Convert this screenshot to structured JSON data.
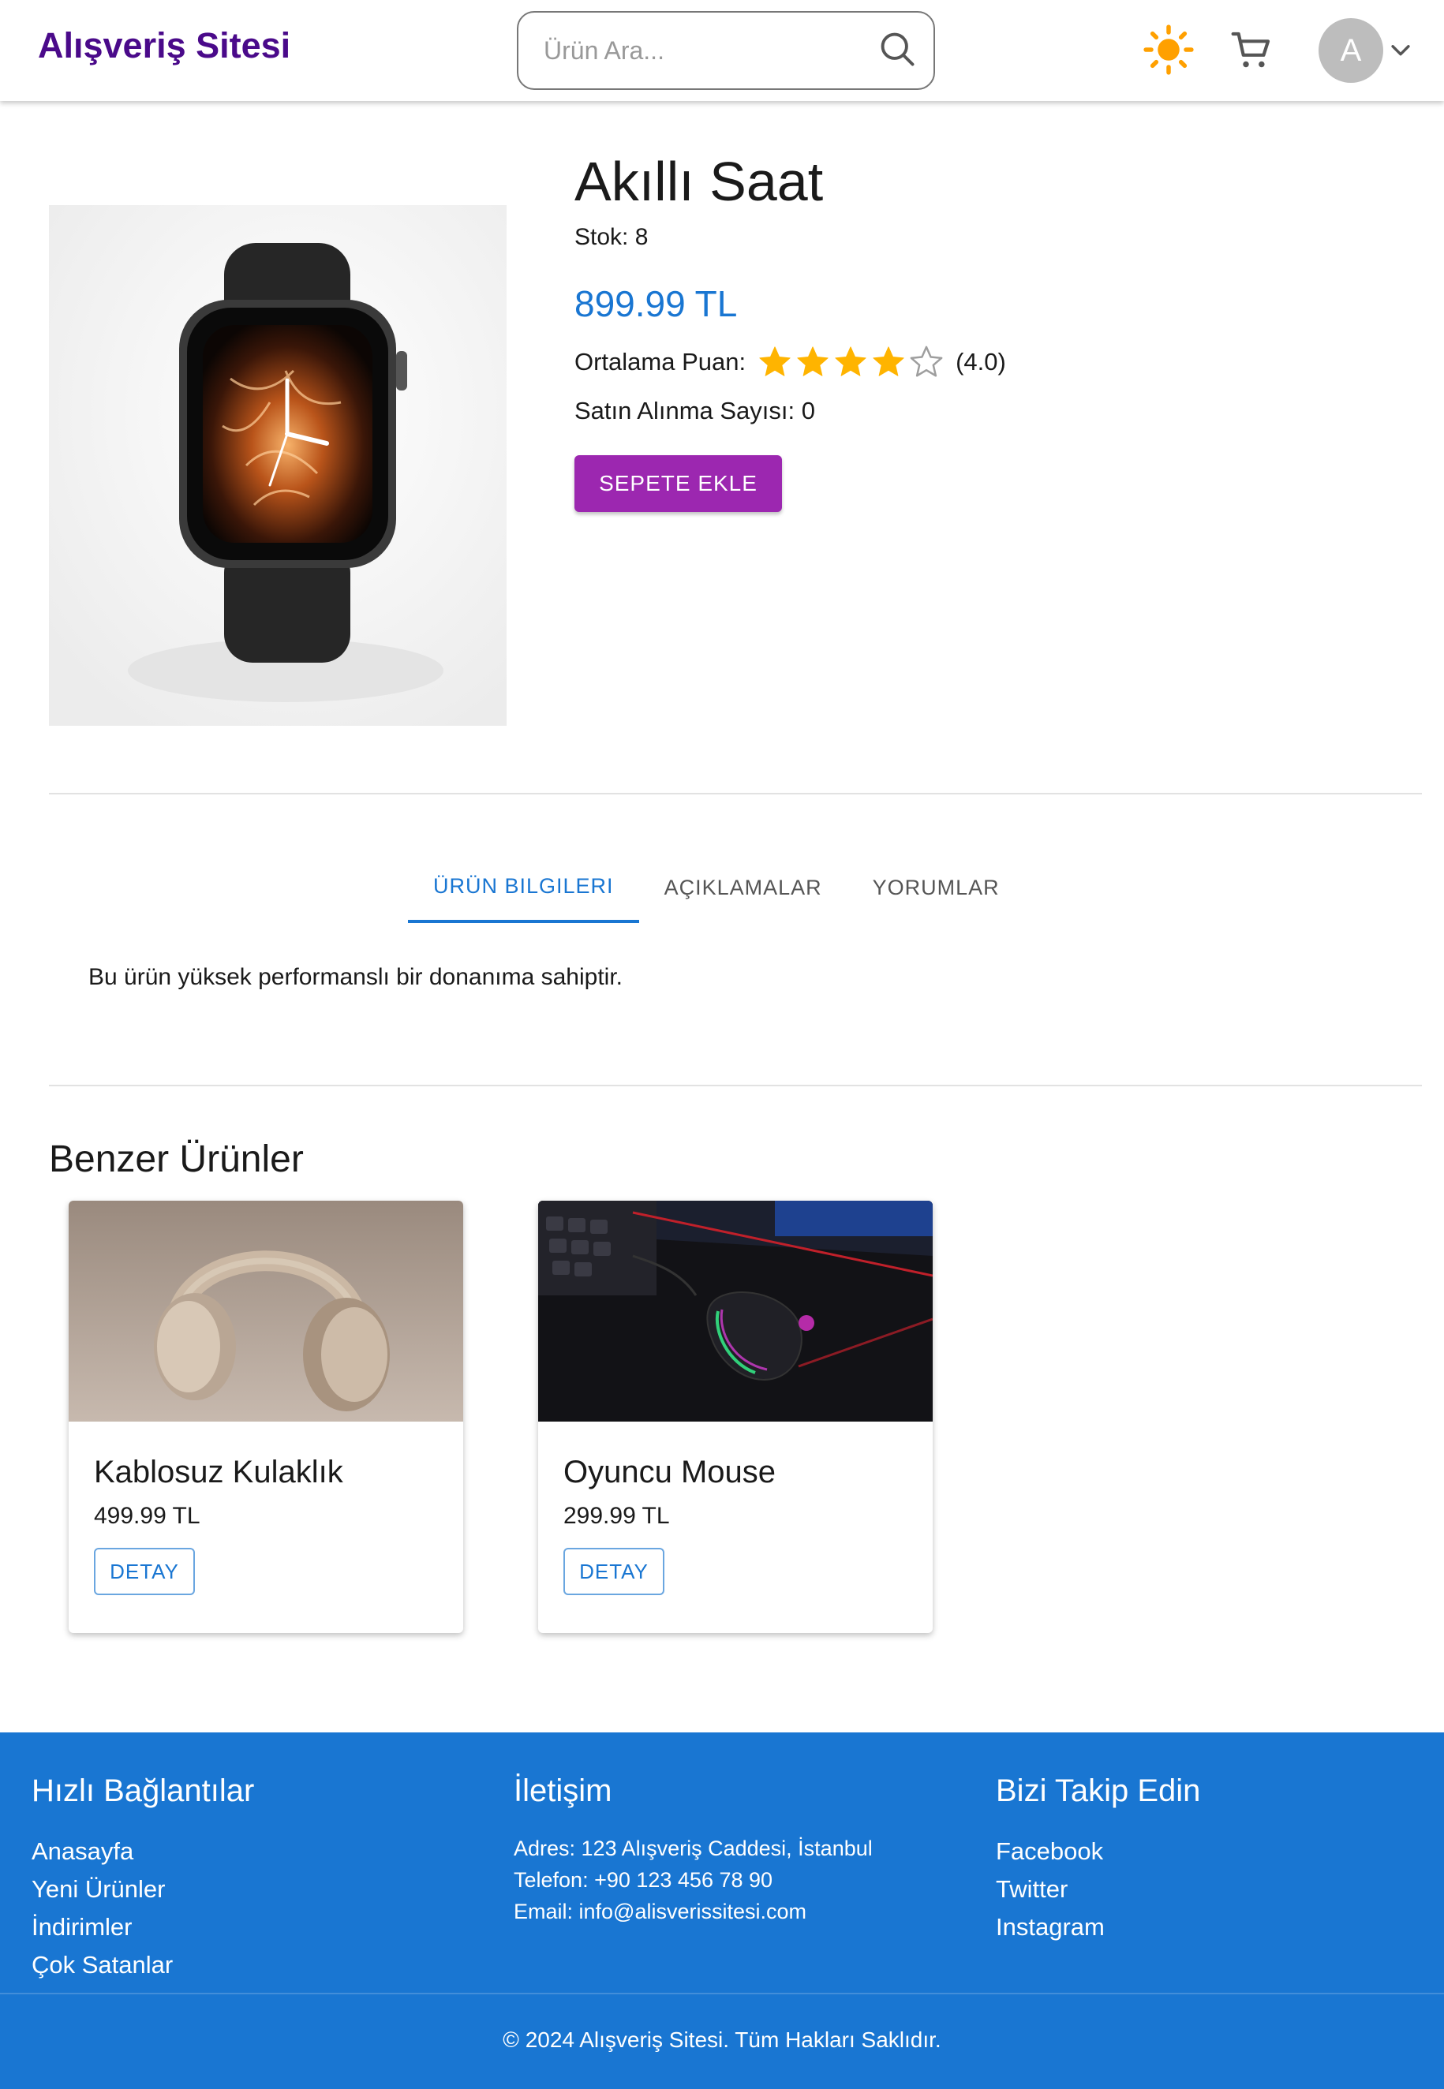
{
  "header": {
    "logo": "Alışveriş Sitesi",
    "search_placeholder": "Ürün Ara...",
    "avatar_letter": "A"
  },
  "product": {
    "title": "Akıllı Saat",
    "stock": "Stok: 8",
    "price": "899.99 TL",
    "rating_label": "Ortalama Puan:",
    "rating_value": 4,
    "rating_max": 5,
    "rating_text": "(4.0)",
    "sales": "Satın Alınma Sayısı: 0",
    "add_to_cart": "SEPETE EKLE"
  },
  "tabs": [
    {
      "label": "ÜRÜN BILGILERI",
      "active": true
    },
    {
      "label": "AÇIKLAMALAR",
      "active": false
    },
    {
      "label": "YORUMLAR",
      "active": false
    }
  ],
  "tab_content": "Bu ürün yüksek performanslı bir donanıma sahiptir.",
  "similar": {
    "title": "Benzer Ürünler",
    "items": [
      {
        "name": "Kablosuz Kulaklık",
        "price": "499.99 TL",
        "button": "DETAY"
      },
      {
        "name": "Oyuncu Mouse",
        "price": "299.99 TL",
        "button": "DETAY"
      }
    ]
  },
  "footer": {
    "quick_links": {
      "title": "Hızlı Bağlantılar",
      "links": [
        "Anasayfa",
        "Yeni Ürünler",
        "İndirimler",
        "Çok Satanlar"
      ]
    },
    "contact": {
      "title": "İletişim",
      "lines": [
        "Adres: 123 Alışveriş Caddesi, İstanbul",
        "Telefon: +90 123 456 78 90",
        "Email: info@alisverissitesi.com"
      ]
    },
    "follow": {
      "title": "Bizi Takip Edin",
      "links": [
        "Facebook",
        "Twitter",
        "Instagram"
      ]
    },
    "copyright": "© 2024 Alışveriş Sitesi. Tüm Hakları Saklıdır."
  },
  "colors": {
    "brand": "#4a0a8a",
    "primary": "#1976d2",
    "cart_button": "#9c27b0",
    "star": "#ffb400",
    "sun": "#ffa000"
  },
  "icons": [
    "search-icon",
    "sun-icon",
    "cart-icon",
    "chevron-down-icon",
    "star-icon"
  ]
}
